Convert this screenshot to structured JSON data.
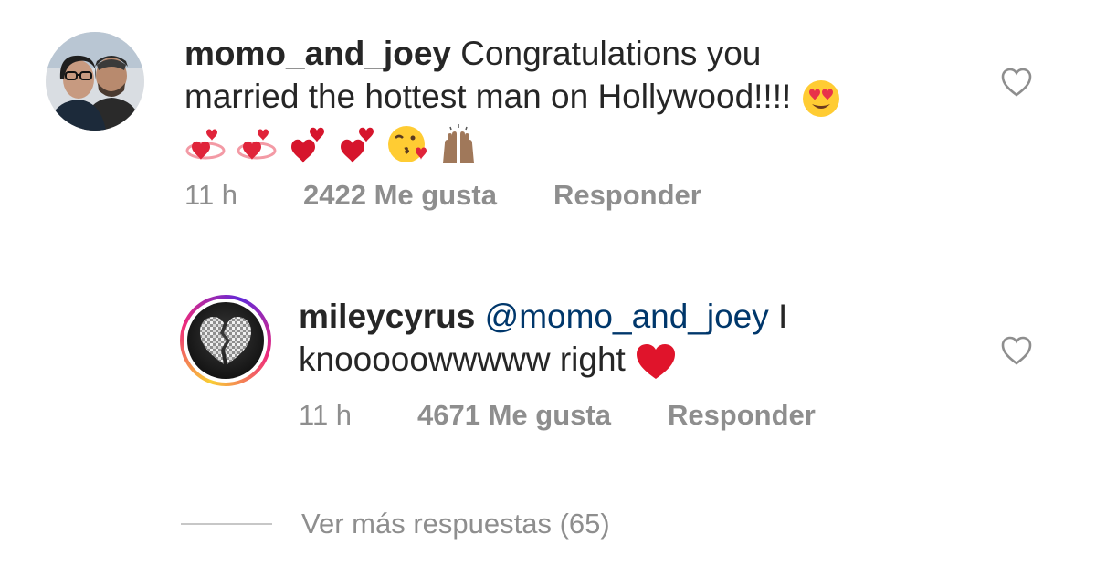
{
  "comments": [
    {
      "username": "momo_and_joey",
      "text_line1": " Congratulations you",
      "text_line2": "married the hottest man on Hollywood!!!! ",
      "emojis": [
        "heart-eyes-emoji",
        "revolving-hearts-emoji",
        "revolving-hearts-emoji",
        "two-hearts-emoji",
        "two-hearts-emoji",
        "kissing-heart-emoji",
        "raised-hands-emoji"
      ],
      "time": "11 h",
      "likes": "2422 Me gusta",
      "reply_label": "Responder"
    },
    {
      "username": "mileycyrus",
      "mention": "@momo_and_joey",
      "text_after_mention": " I",
      "text_line2": "knooooowwwww right ",
      "emojis": [
        "red-heart-emoji"
      ],
      "time": "11 h",
      "likes": "4671 Me gusta",
      "reply_label": "Responder"
    }
  ],
  "view_more_replies": "Ver más respuestas (65)",
  "colors": {
    "text": "#262626",
    "secondary": "#8e8e8e",
    "mention": "#00376b",
    "story_ring": [
      "#f9ce34",
      "#ee2a7b",
      "#6228d7"
    ]
  }
}
